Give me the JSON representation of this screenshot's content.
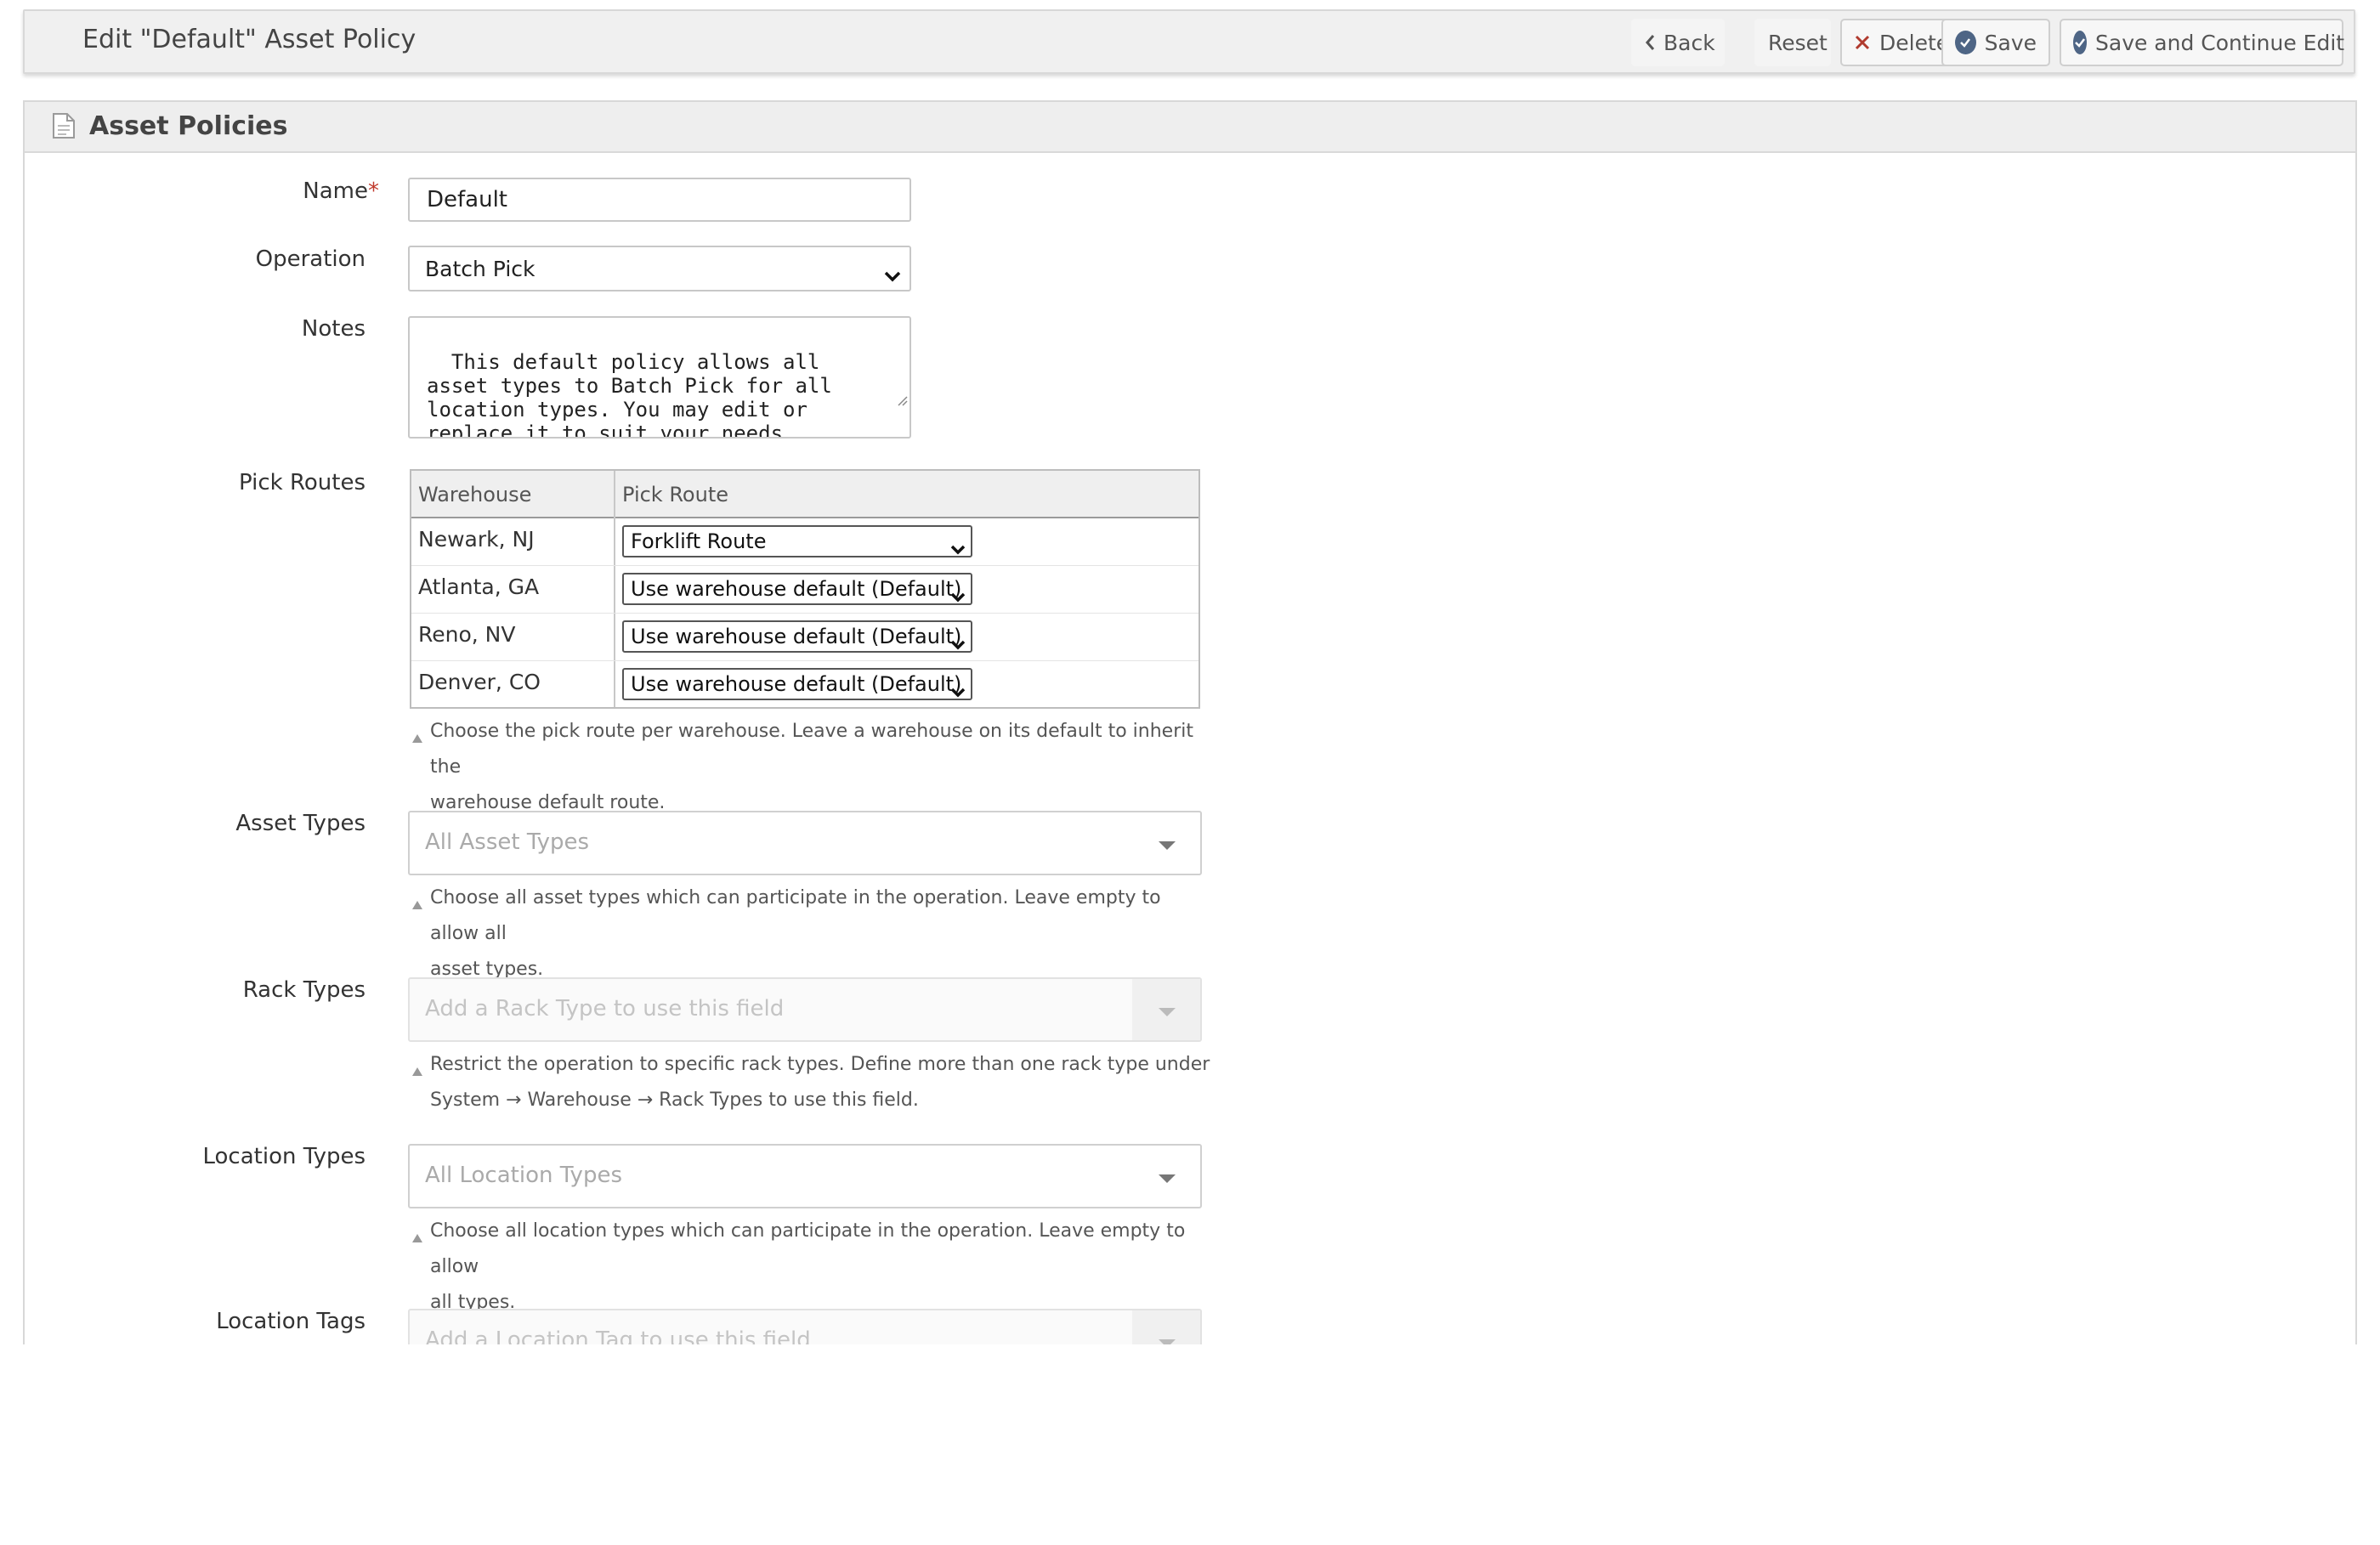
{
  "header": {
    "title": "Edit \"Default\" Asset Policy",
    "buttons": {
      "back": "Back",
      "reset": "Reset",
      "delete": "Delete",
      "save": "Save",
      "save_continue": "Save and Continue Edit"
    }
  },
  "panel": {
    "title": "Asset Policies"
  },
  "form": {
    "name": {
      "label": "Name",
      "required_mark": "*",
      "value": "Default"
    },
    "operation": {
      "label": "Operation",
      "value": "Batch Pick"
    },
    "notes": {
      "label": "Notes",
      "value": "This default policy allows all asset types to Batch Pick for all location types. You may edit or replace it to suit your needs."
    },
    "pick_routes": {
      "label": "Pick Routes",
      "columns": [
        "Warehouse",
        "Pick Route"
      ],
      "rows": [
        {
          "warehouse": "Newark, NJ",
          "route": "Forklift Route"
        },
        {
          "warehouse": "Atlanta, GA",
          "route": "Use warehouse default (Default)"
        },
        {
          "warehouse": "Reno, NV",
          "route": "Use warehouse default (Default)"
        },
        {
          "warehouse": "Denver, CO",
          "route": "Use warehouse default (Default)"
        }
      ],
      "help_line1": "Choose the pick route per warehouse. Leave a warehouse on its default to inherit the",
      "help_line2": "warehouse default route."
    },
    "asset_types": {
      "label": "Asset Types",
      "placeholder": "All Asset Types",
      "help_line1": "Choose all asset types which can participate in the operation. Leave empty to allow all",
      "help_line2": "asset types."
    },
    "rack_types": {
      "label": "Rack Types",
      "placeholder": "Add a Rack Type to use this field",
      "help_line1": "Restrict the operation to specific rack types. Define more than one rack type under",
      "help_line2": "System → Warehouse → Rack Types to use this field."
    },
    "location_types": {
      "label": "Location Types",
      "placeholder": "All Location Types",
      "help_line1": "Choose all location types which can participate in the operation. Leave empty to allow",
      "help_line2": "all types."
    },
    "location_tags": {
      "label": "Location Tags",
      "placeholder": "Add a Location Tag to use this field"
    }
  },
  "colors": {
    "accent_circle": "#4e6585",
    "delete_x": "#c0392b",
    "required": "#c0392b"
  },
  "icons": [
    "chevron-left-icon",
    "close-icon",
    "check-circle-icon",
    "document-icon",
    "caret-down-icon",
    "help-triangle-icon"
  ]
}
